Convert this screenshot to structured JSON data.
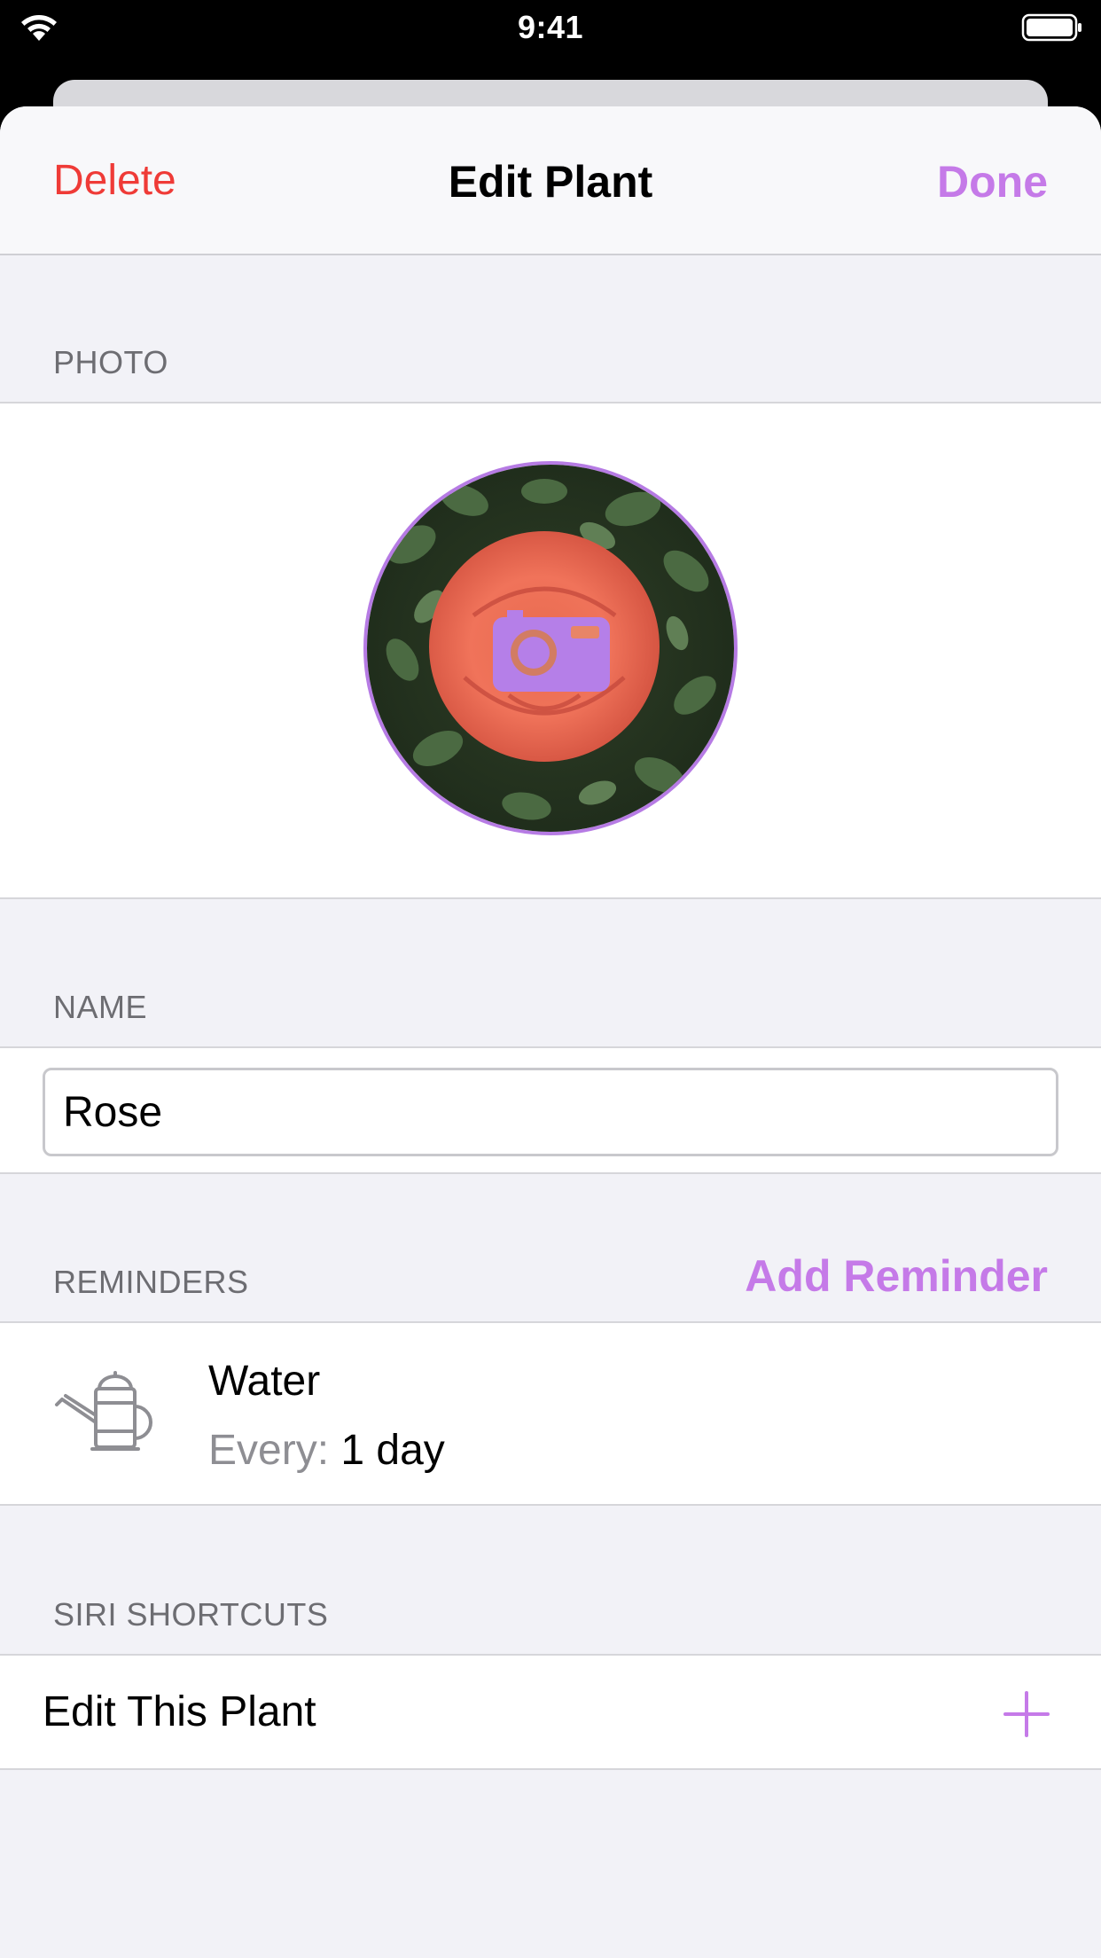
{
  "status_bar": {
    "time": "9:41",
    "wifi_icon": "wifi-icon",
    "battery_icon": "battery-icon"
  },
  "nav": {
    "left": "Delete",
    "title": "Edit Plant",
    "right": "Done"
  },
  "sections": {
    "photo": "PHOTO",
    "name": "NAME",
    "reminders": "REMINDERS",
    "siri": "SIRI SHORTCUTS"
  },
  "photo": {
    "image": "rose-photo",
    "overlay_icon": "camera-icon"
  },
  "name_field": {
    "value": "Rose"
  },
  "reminders": {
    "add_label": "Add Reminder",
    "items": [
      {
        "icon": "watering-can-icon",
        "title": "Water",
        "every_label": "Every:",
        "every_value": "1 day"
      }
    ]
  },
  "siri": {
    "items": [
      {
        "label": "Edit This Plant",
        "icon": "plus-icon"
      }
    ]
  },
  "colors": {
    "accent": "#c57ae8",
    "destructive": "#ef3b37",
    "background": "#f2f2f7"
  }
}
